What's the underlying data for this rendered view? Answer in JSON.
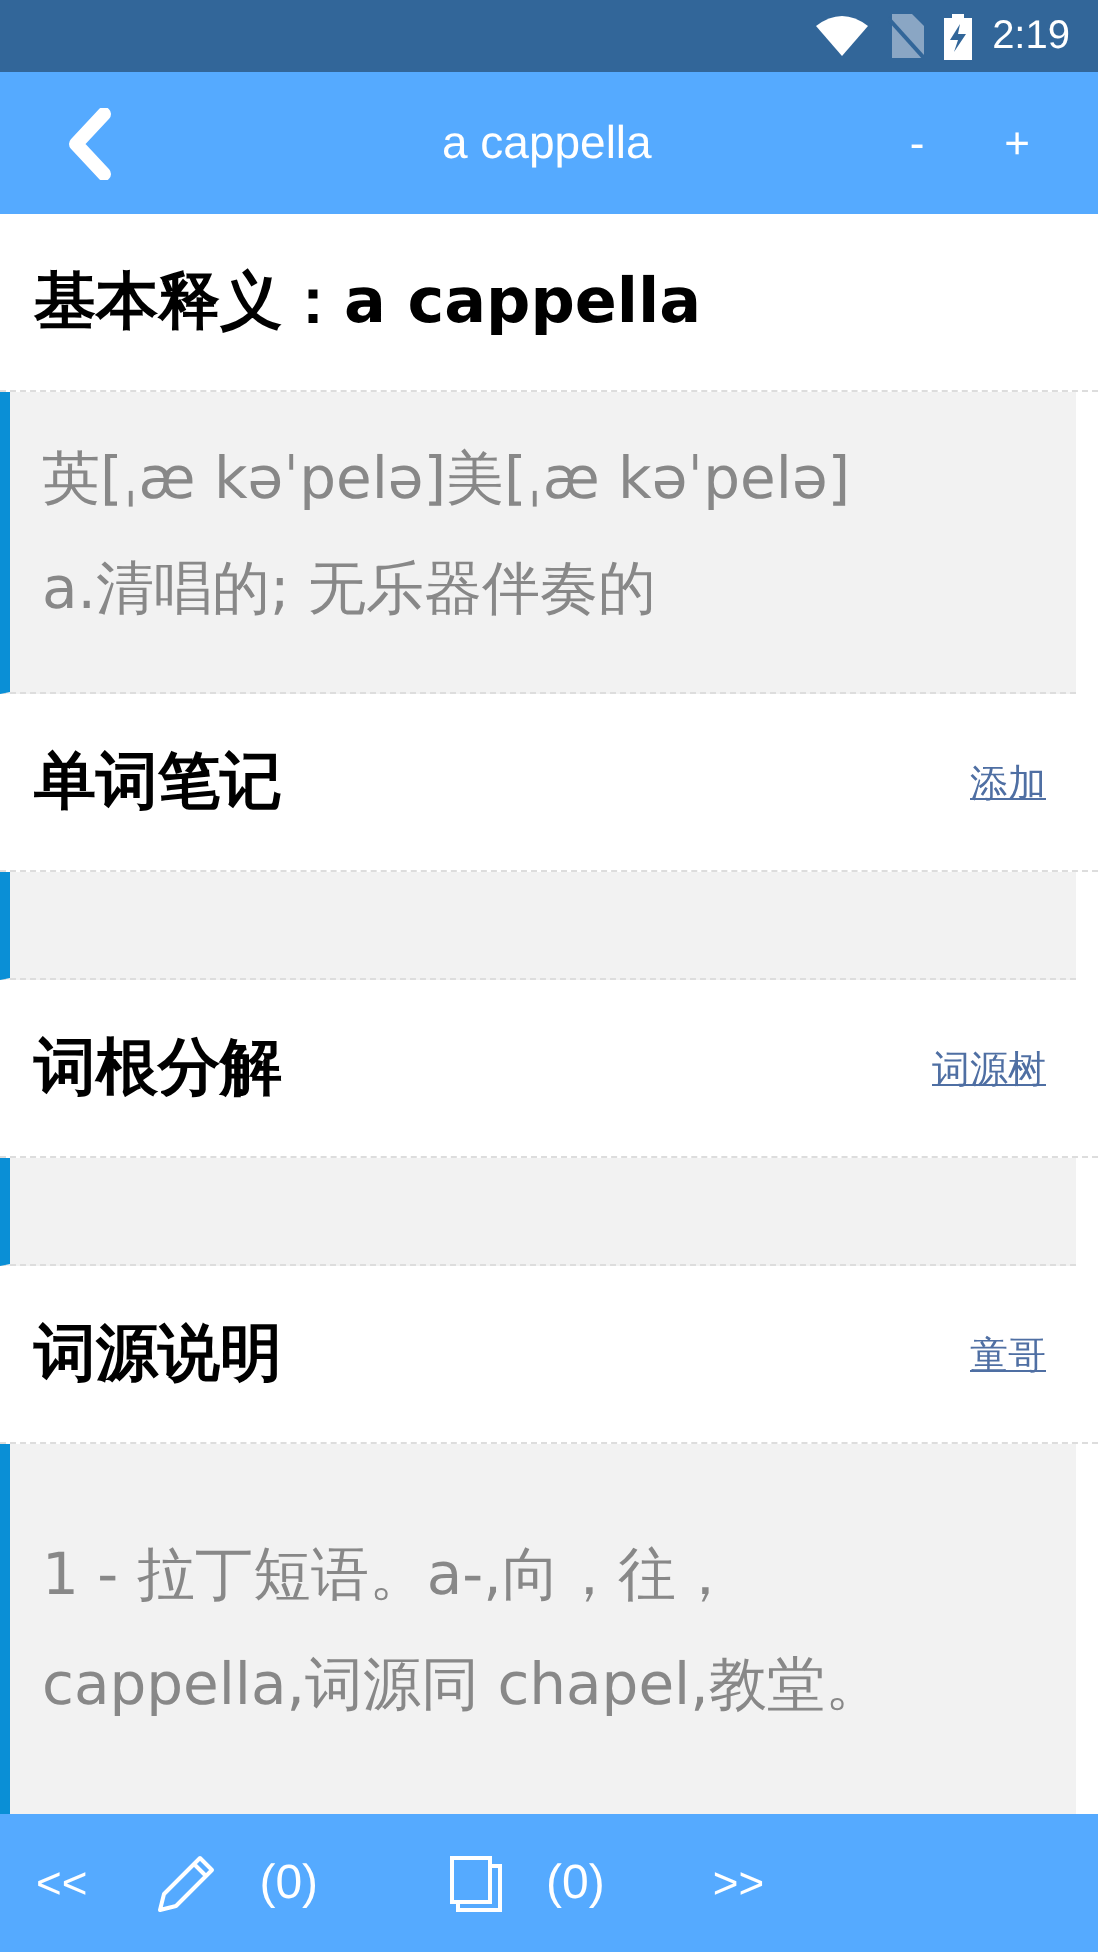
{
  "status_bar": {
    "time": "2:19"
  },
  "app_bar": {
    "title": "a cappella",
    "minus": "-",
    "plus": "+"
  },
  "sections": [
    {
      "title": "基本释义：a cappella",
      "lines": [
        "英[ˌæ kəˈpelə]美[ˌæ kəˈpelə]",
        "a.清唱的; 无乐器伴奏的"
      ]
    },
    {
      "title": "单词笔记",
      "link": "添加"
    },
    {
      "title": "词根分解",
      "link": "词源树"
    },
    {
      "title": "词源说明",
      "link": "童哥",
      "lines": [
        "1 - 拉丁短语。a-,向，往，",
        "cappella,词源同 chapel,教堂。"
      ]
    }
  ],
  "bottom_bar": {
    "prev": "<<",
    "notes_count": "(0)",
    "book_count": "(0)",
    "next": ">>"
  }
}
